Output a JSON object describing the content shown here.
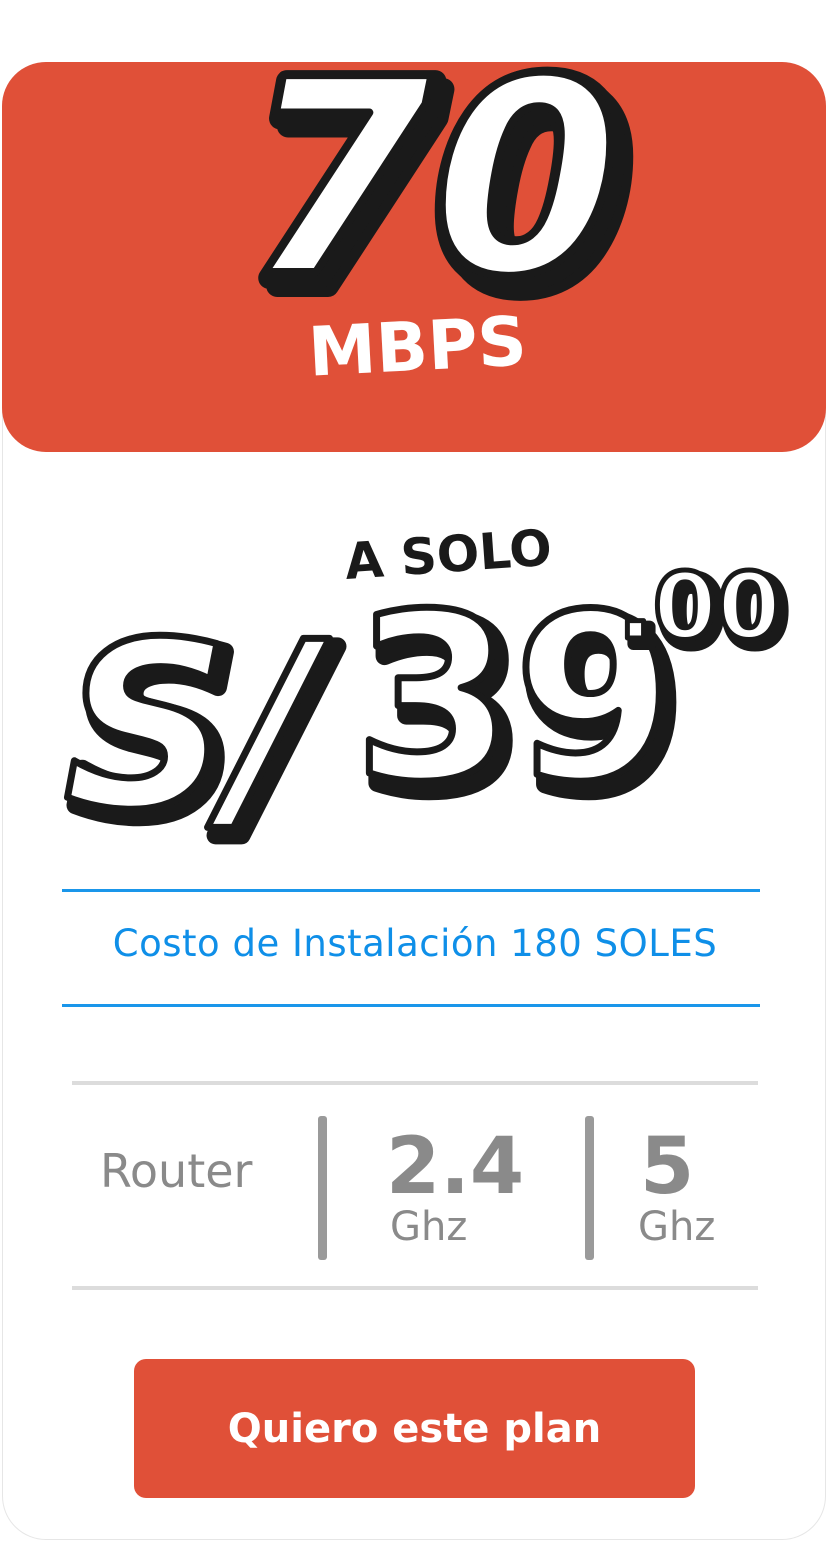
{
  "plan": {
    "speed_value": "70",
    "speed_unit": "MBPS"
  },
  "price": {
    "prefix": "A SOLO",
    "currency": "S/",
    "amount": "39",
    "cents": ".00"
  },
  "installation": {
    "text": "Costo de Instalación 180 SOLES"
  },
  "router": {
    "label": "Router",
    "bands": [
      {
        "value": "2.4",
        "unit": "Ghz"
      },
      {
        "value": "5",
        "unit": "Ghz"
      }
    ]
  },
  "cta": {
    "label": "Quiero este plan"
  },
  "colors": {
    "brand": "#e05038",
    "accent_blue": "#0f8fe8",
    "muted_gray": "#8a8a8a",
    "outline": "#1a1a1a"
  }
}
